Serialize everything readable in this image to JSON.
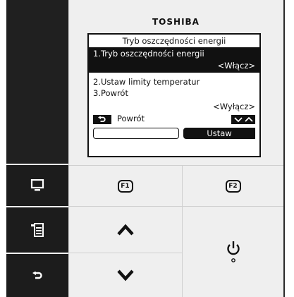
{
  "brand": "TOSHIBA",
  "screen": {
    "title": "Tryb oszczędności energii",
    "selected_item": "1.Tryb oszczędności energii",
    "selected_value": "<Włącz>",
    "item2": "2.Ustaw limity temperatur",
    "item3": "3.Powrót",
    "item3_value": "<Wyłącz>",
    "back_label": "Powrót",
    "confirm_label": "Ustaw"
  },
  "keys": {
    "f1": "F1",
    "f2": "F2"
  },
  "icons": {
    "left": [
      "monitor-icon",
      "menu-list-icon",
      "return-icon"
    ],
    "center": [
      "chevron-up-icon",
      "chevron-down-icon"
    ],
    "right": [
      "power-icon"
    ]
  },
  "colors": {
    "panel_dark": "#1c1c1c",
    "panel_light": "#efefef",
    "screen_bg": "#ffffff",
    "screen_ink": "#111111"
  }
}
